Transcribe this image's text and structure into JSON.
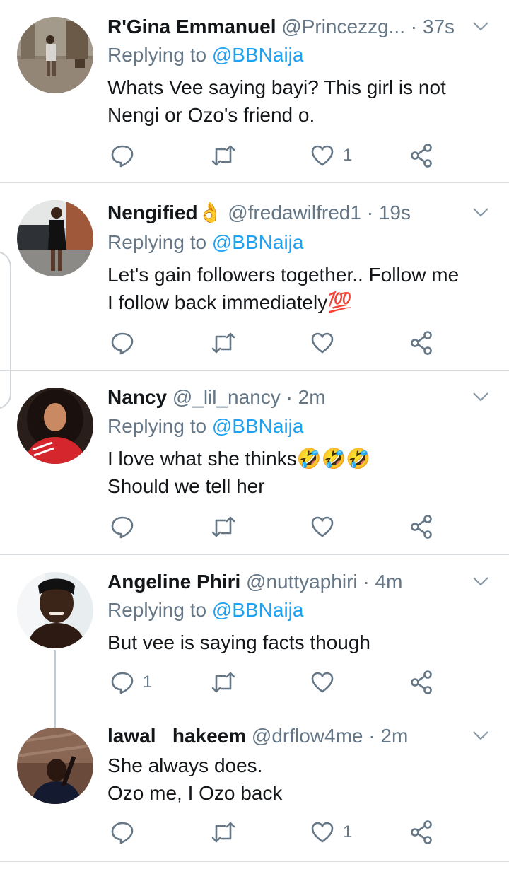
{
  "tweets": [
    {
      "name": "R'Gina Emmanuel",
      "handle": "@Princezzg...",
      "time": "· 37s",
      "replying_prefix": "Replying to",
      "replying_to": "@BBNaija",
      "lines": [
        "Whats Vee saying bayi? This girl is not",
        "Nengi or Ozo's friend o."
      ],
      "reply_count": "",
      "like_count": "1"
    },
    {
      "name": "Nengified",
      "name_emoji": "👌",
      "handle": "@fredawilfred1",
      "time": "· 19s",
      "replying_prefix": "Replying to",
      "replying_to": "@BBNaija",
      "lines": [
        "Let's gain followers together..  Follow me",
        "I follow back immediately💯"
      ],
      "reply_count": "",
      "like_count": ""
    },
    {
      "name": "Nancy",
      "handle": "@_lil_nancy",
      "time": "· 2m",
      "replying_prefix": "Replying to",
      "replying_to": "@BBNaija",
      "lines": [
        "I love what she thinks🤣🤣🤣",
        "Should we tell her"
      ],
      "reply_count": "",
      "like_count": ""
    },
    {
      "name": "Angeline Phiri",
      "handle": "@nuttyaphiri",
      "time": "· 4m",
      "replying_prefix": "Replying to",
      "replying_to": "@BBNaija",
      "lines": [
        "But vee is saying facts though"
      ],
      "reply_count": "1",
      "like_count": ""
    },
    {
      "name": "lawal   hakeem",
      "handle": "@drflow4me",
      "time": "· 2m",
      "lines": [
        "She always does.",
        "Ozo me, I Ozo back"
      ],
      "reply_count": "",
      "like_count": "1"
    }
  ],
  "colors": {
    "link": "#1da1f2",
    "secondary": "#657786",
    "text": "#14171a",
    "divider": "#d8dde2"
  },
  "icons": [
    "reply-icon",
    "retweet-icon",
    "like-icon",
    "share-icon",
    "chevron-down-icon"
  ]
}
